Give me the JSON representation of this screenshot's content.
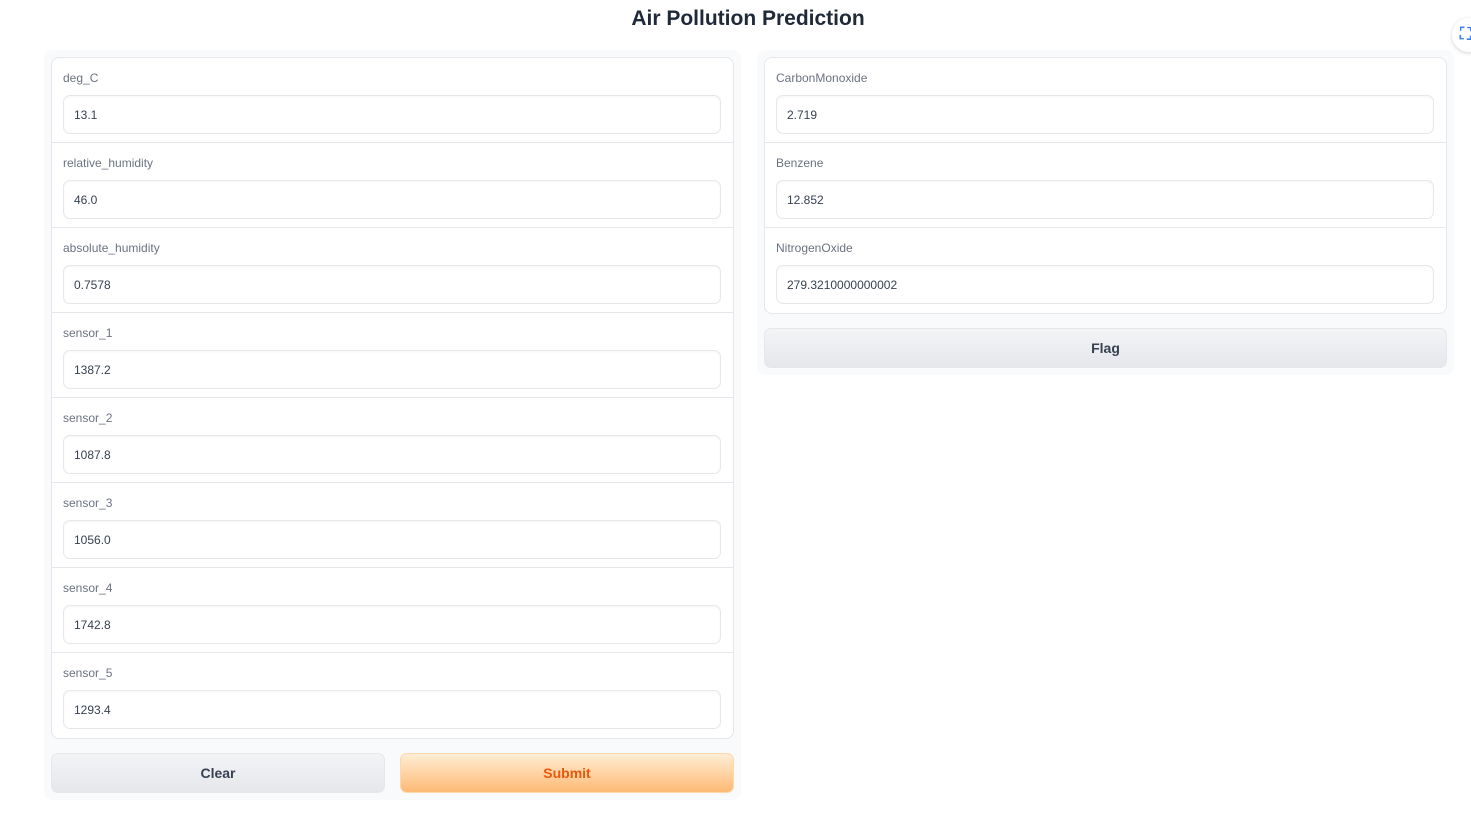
{
  "header": {
    "title": "Air Pollution Prediction",
    "corner_icon_glyph": "⛶",
    "corner_icon_name": "fullscreen-icon"
  },
  "inputs": [
    {
      "label": "deg_C",
      "value": "13.1"
    },
    {
      "label": "relative_humidity",
      "value": "46.0"
    },
    {
      "label": "absolute_humidity",
      "value": "0.7578"
    },
    {
      "label": "sensor_1",
      "value": "1387.2"
    },
    {
      "label": "sensor_2",
      "value": "1087.8"
    },
    {
      "label": "sensor_3",
      "value": "1056.0"
    },
    {
      "label": "sensor_4",
      "value": "1742.8"
    },
    {
      "label": "sensor_5",
      "value": "1293.4"
    }
  ],
  "outputs": [
    {
      "label": "CarbonMonoxide",
      "value": "2.719"
    },
    {
      "label": "Benzene",
      "value": "12.852"
    },
    {
      "label": "NitrogenOxide",
      "value": "279.3210000000002"
    }
  ],
  "buttons": {
    "clear": "Clear",
    "submit": "Submit",
    "flag": "Flag"
  },
  "colors": {
    "accent": "#ea580c",
    "primary_gradient_top": "#ffedd5",
    "primary_gradient_bottom": "#fdba74"
  }
}
